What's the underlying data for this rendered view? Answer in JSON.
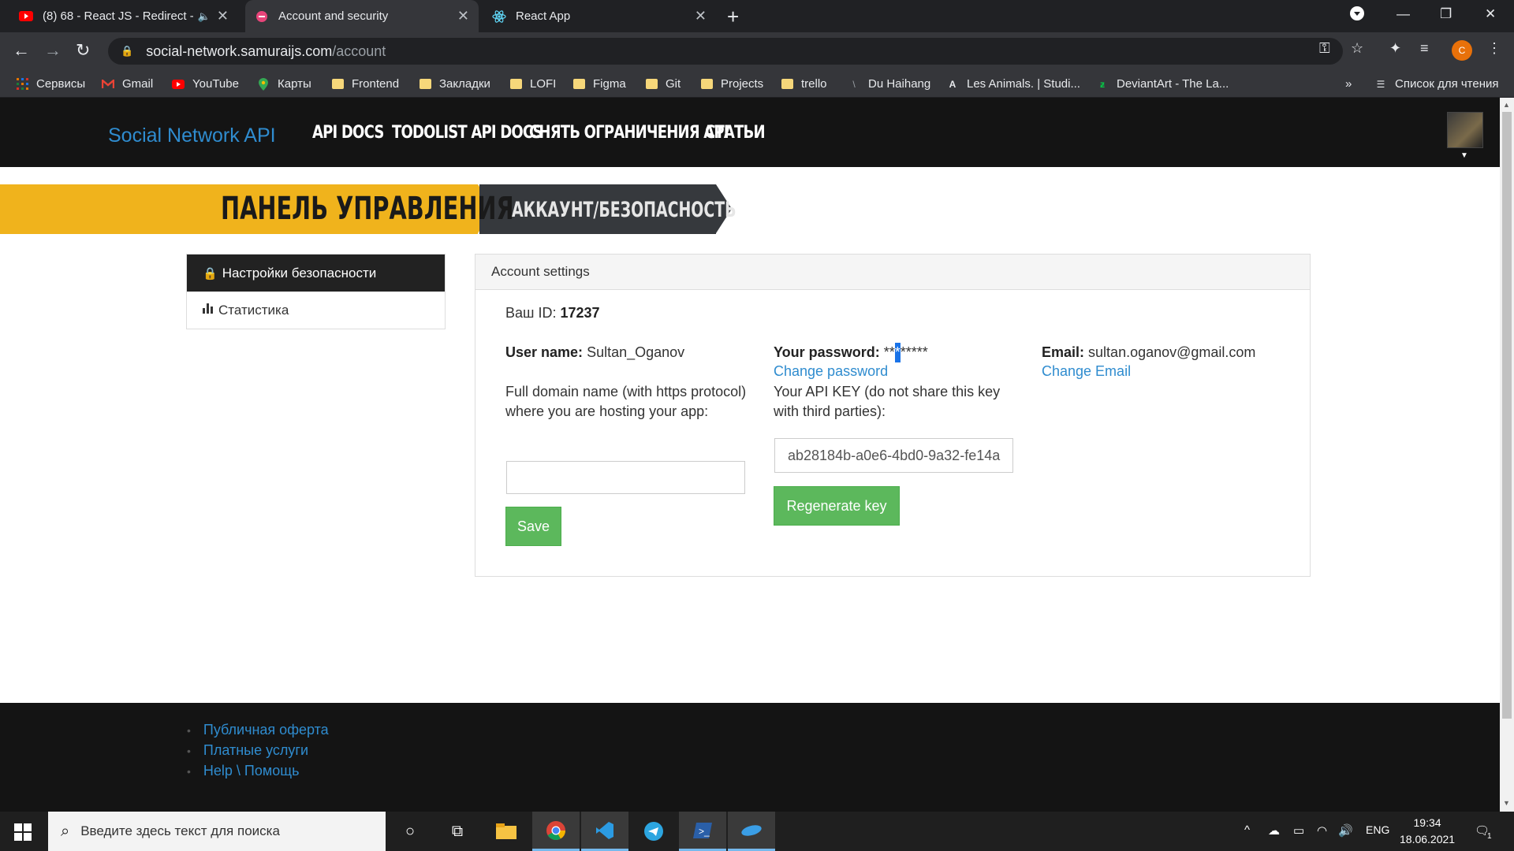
{
  "browser": {
    "tabs": [
      {
        "title": "(8) 68 - React JS - Redirect - ",
        "icon": "youtube-icon",
        "active": false
      },
      {
        "title": "Account and security",
        "icon": "samurai-icon",
        "active": true
      },
      {
        "title": "React App",
        "icon": "react-icon",
        "active": false
      }
    ],
    "url_host": "social-network.samuraijs.com",
    "url_path": "/account",
    "profile_letter": "C",
    "bookmarks": [
      {
        "label": "Сервисы",
        "icon": "apps-icon"
      },
      {
        "label": "Gmail",
        "icon": "gmail-icon"
      },
      {
        "label": "YouTube",
        "icon": "youtube-icon"
      },
      {
        "label": "Карты",
        "icon": "maps-icon"
      },
      {
        "label": "Frontend",
        "icon": "folder-icon"
      },
      {
        "label": "Закладки",
        "icon": "folder-icon"
      },
      {
        "label": "LOFI",
        "icon": "folder-icon"
      },
      {
        "label": "Figma",
        "icon": "folder-icon"
      },
      {
        "label": "Git",
        "icon": "folder-icon"
      },
      {
        "label": "Projects",
        "icon": "folder-icon"
      },
      {
        "label": "trello",
        "icon": "folder-icon"
      },
      {
        "label": "Du Haihang",
        "icon": "site-icon"
      },
      {
        "label": "Les Animals. | Studi...",
        "icon": "site-icon"
      },
      {
        "label": "DeviantArt - The La...",
        "icon": "deviantart-icon"
      }
    ],
    "bookmarks_more": "»",
    "reading_list": "Список для чтения"
  },
  "site": {
    "brand": "Social Network API",
    "nav": [
      "API DOCS",
      "TODOLIST API DOCS",
      "СНЯТЬ ОГРАНИЧЕНИЯ API",
      "СТАТЬИ"
    ],
    "banner_title": "ПАНЕЛЬ УПРАВЛЕНИЯ",
    "banner_sub": "АККАУНТ/БЕЗОПАСНОСТЬ"
  },
  "sidebar": {
    "items": [
      {
        "label": "Настройки безопасности",
        "icon": "lock-icon",
        "active": true
      },
      {
        "label": "Статистика",
        "icon": "bar-chart-icon",
        "active": false
      }
    ]
  },
  "account": {
    "header": "Account settings",
    "id_label": "Ваш ID:",
    "id_value": "17237",
    "username_label": "User name:",
    "username_value": "Sultan_Oganov",
    "password_label": "Your password:",
    "password_before": "**",
    "password_selected": "*",
    "password_after": "*****",
    "change_password": "Change password",
    "apikey_label": "Your API KEY (do not share this key with third parties):",
    "apikey_value": "ab28184b-a0e6-4bd0-9a32-fe14a",
    "regenerate": "Regenerate key",
    "email_label": "Email:",
    "email_value": "sultan.oganov@gmail.com",
    "change_email": "Change Email",
    "domain_label": "Full domain name (with https protocol) where you are hosting your app:",
    "domain_value": "",
    "save": "Save"
  },
  "footer": {
    "links": [
      "Публичная оферта",
      "Платные услуги",
      "Help \\ Помощь"
    ]
  },
  "taskbar": {
    "search_placeholder": "Введите здесь текст для поиска",
    "lang": "ENG",
    "time": "19:34",
    "date": "18.06.2021",
    "notification_count": "1"
  }
}
